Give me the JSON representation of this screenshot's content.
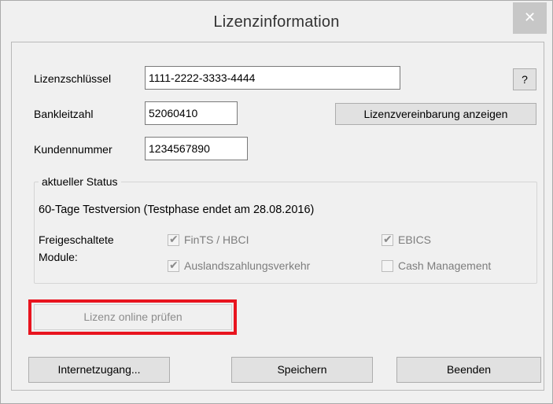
{
  "window": {
    "title": "Lizenzinformation",
    "close_glyph": "✕"
  },
  "license": {
    "key_label": "Lizenzschlüssel",
    "key_value": "1111-2222-3333-4444",
    "bank_label": "Bankleitzahl",
    "bank_value": "52060410",
    "customer_label": "Kundennummer",
    "customer_value": "1234567890",
    "help_label": "?",
    "show_agreement_label": "Lizenzvereinbarung anzeigen"
  },
  "status": {
    "group_title": "aktueller Status",
    "text": "60-Tage Testversion (Testphase endet am 28.08.2016)",
    "modules_label_line1": "Freigeschaltete",
    "modules_label_line2": "Module:",
    "modules": [
      {
        "label": "FinTS / HBCI",
        "checked": true
      },
      {
        "label": "EBICS",
        "checked": true
      },
      {
        "label": "Auslandszahlungsverkehr",
        "checked": true
      },
      {
        "label": "Cash Management",
        "checked": false
      }
    ]
  },
  "actions": {
    "online_check_label": "Lizenz online prüfen",
    "internet_label": "Internetzugang...",
    "save_label": "Speichern",
    "exit_label": "Beenden"
  },
  "colors": {
    "highlight": "#e8141f",
    "close_button_bg": "#c7c7c7"
  }
}
